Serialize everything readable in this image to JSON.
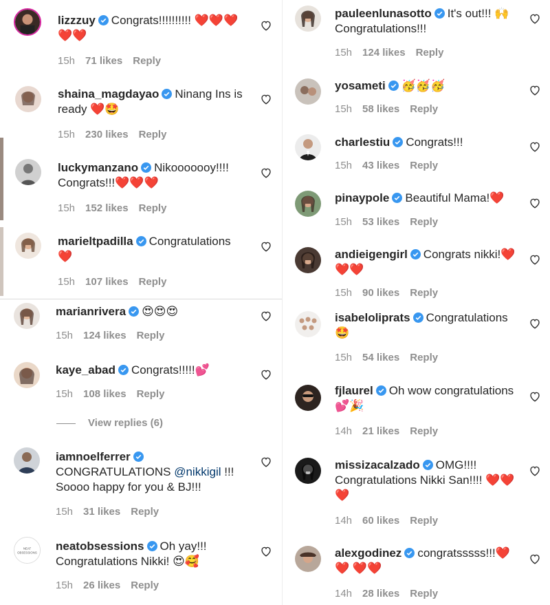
{
  "left": [
    {
      "username": "lizzzuy",
      "text": "Congrats!!!!!!!!!! ❤️❤️❤️❤️❤️",
      "time": "15h",
      "likes": "71 likes",
      "reply": "Reply"
    },
    {
      "username": "shaina_magdayao",
      "text": "Ninang Ins is ready ❤️🤩",
      "time": "15h",
      "likes": "230 likes",
      "reply": "Reply"
    },
    {
      "username": "luckymanzano",
      "text": "Nikooooooy!!!! Congrats!!!❤️❤️❤️",
      "time": "15h",
      "likes": "152 likes",
      "reply": "Reply"
    },
    {
      "username": "marieltpadilla",
      "text": "Congratulations ❤️",
      "time": "15h",
      "likes": "107 likes",
      "reply": "Reply"
    },
    {
      "username": "marianrivera",
      "text": "😍😍😍",
      "time": "15h",
      "likes": "124 likes",
      "reply": "Reply"
    },
    {
      "username": "kaye_abad",
      "text": "Congrats!!!!!💕",
      "time": "15h",
      "likes": "108 likes",
      "reply": "Reply"
    },
    {
      "username": "iamnoelferrer",
      "text_pre": "CONGRATULATIONS ",
      "mention": "@nikkigil",
      "text_post": " !!! Soooo happy for you & BJ!!!",
      "time": "15h",
      "likes": "31 likes",
      "reply": "Reply"
    },
    {
      "username": "neatobsessions",
      "avatar_text": "NEAT OBSESSIONS",
      "text": "Oh yay!!! Congratulations Nikki! 😍🥰",
      "time": "15h",
      "likes": "26 likes",
      "reply": "Reply"
    }
  ],
  "view_replies": "View replies (6)",
  "right": [
    {
      "username": "pauleenlunasotto",
      "text": "It's out!!! 🙌 Congratulations!!!",
      "time": "15h",
      "likes": "124 likes",
      "reply": "Reply"
    },
    {
      "username": "yosameti",
      "text": "🥳🥳🥳",
      "time": "15h",
      "likes": "58 likes",
      "reply": "Reply"
    },
    {
      "username": "charlestiu",
      "text": "Congrats!!!",
      "time": "15h",
      "likes": "43 likes",
      "reply": "Reply"
    },
    {
      "username": "pinaypole",
      "text": "Beautiful Mama!❤️",
      "time": "15h",
      "likes": "53 likes",
      "reply": "Reply"
    },
    {
      "username": "andieigengirl",
      "text": "Congrats nikki!❤️ ❤️❤️",
      "time": "15h",
      "likes": "90 likes",
      "reply": "Reply"
    },
    {
      "username": "isabeloliprats",
      "text": "Congratulations 🤩",
      "time": "15h",
      "likes": "54 likes",
      "reply": "Reply"
    },
    {
      "username": "fjlaurel",
      "text": "Oh wow congratulations 💕🎉",
      "time": "14h",
      "likes": "21 likes",
      "reply": "Reply"
    },
    {
      "username": "missizacalzado",
      "text": "OMG!!!! Congratulations Nikki San!!!! ❤️❤️ ❤️",
      "time": "14h",
      "likes": "60 likes",
      "reply": "Reply"
    },
    {
      "username": "alexgodinez",
      "text": "congratsssss!!!❤️❤️ ❤️❤️",
      "time": "14h",
      "likes": "28 likes",
      "reply": "Reply"
    }
  ],
  "colors": {
    "verified": "#3897f0",
    "meta": "#8e8e8e",
    "text": "#262626",
    "mention": "#00376b"
  }
}
